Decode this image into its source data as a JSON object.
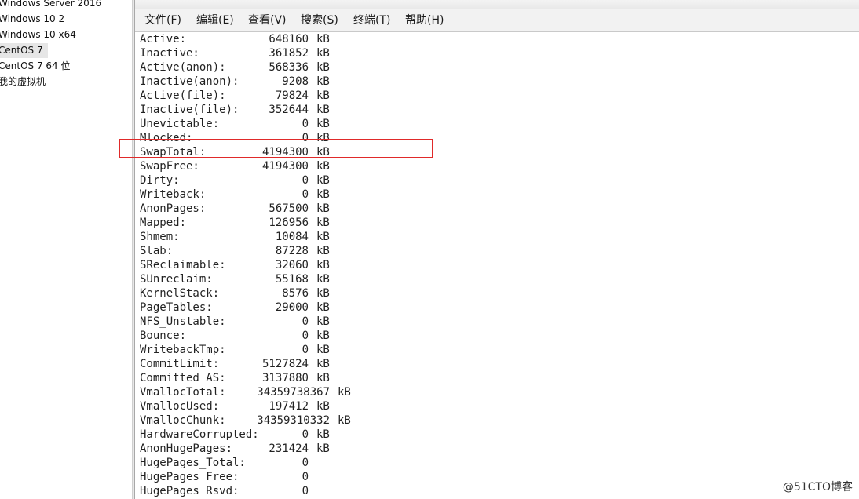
{
  "library": {
    "items": [
      {
        "label": "Windows Server 2016",
        "selected": false
      },
      {
        "label": "Windows 10 2",
        "selected": false
      },
      {
        "label": "Windows 10 x64",
        "selected": false
      },
      {
        "label": "CentOS 7",
        "selected": true
      },
      {
        "label": "CentOS 7 64 位",
        "selected": false
      },
      {
        "label": "我的虚拟机",
        "selected": false
      }
    ]
  },
  "menubar": {
    "items": [
      "文件(F)",
      "编辑(E)",
      "查看(V)",
      "搜索(S)",
      "终端(T)",
      "帮助(H)"
    ]
  },
  "meminfo": {
    "highlighted_key": "SwapTotal:",
    "rows": [
      {
        "key": "Active:",
        "value": "648160",
        "unit": "kB"
      },
      {
        "key": "Inactive:",
        "value": "361852",
        "unit": "kB"
      },
      {
        "key": "Active(anon):",
        "value": "568336",
        "unit": "kB"
      },
      {
        "key": "Inactive(anon):",
        "value": "9208",
        "unit": "kB"
      },
      {
        "key": "Active(file):",
        "value": "79824",
        "unit": "kB"
      },
      {
        "key": "Inactive(file):",
        "value": "352644",
        "unit": "kB"
      },
      {
        "key": "Unevictable:",
        "value": "0",
        "unit": "kB"
      },
      {
        "key": "Mlocked:",
        "value": "0",
        "unit": "kB"
      },
      {
        "key": "SwapTotal:",
        "value": "4194300",
        "unit": "kB"
      },
      {
        "key": "SwapFree:",
        "value": "4194300",
        "unit": "kB"
      },
      {
        "key": "Dirty:",
        "value": "0",
        "unit": "kB"
      },
      {
        "key": "Writeback:",
        "value": "0",
        "unit": "kB"
      },
      {
        "key": "AnonPages:",
        "value": "567500",
        "unit": "kB"
      },
      {
        "key": "Mapped:",
        "value": "126956",
        "unit": "kB"
      },
      {
        "key": "Shmem:",
        "value": "10084",
        "unit": "kB"
      },
      {
        "key": "Slab:",
        "value": "87228",
        "unit": "kB"
      },
      {
        "key": "SReclaimable:",
        "value": "32060",
        "unit": "kB"
      },
      {
        "key": "SUnreclaim:",
        "value": "55168",
        "unit": "kB"
      },
      {
        "key": "KernelStack:",
        "value": "8576",
        "unit": "kB"
      },
      {
        "key": "PageTables:",
        "value": "29000",
        "unit": "kB"
      },
      {
        "key": "NFS_Unstable:",
        "value": "0",
        "unit": "kB"
      },
      {
        "key": "Bounce:",
        "value": "0",
        "unit": "kB"
      },
      {
        "key": "WritebackTmp:",
        "value": "0",
        "unit": "kB"
      },
      {
        "key": "CommitLimit:",
        "value": "5127824",
        "unit": "kB"
      },
      {
        "key": "Committed_AS:",
        "value": "3137880",
        "unit": "kB"
      },
      {
        "key": "VmallocTotal:",
        "value": "34359738367",
        "unit": "kB"
      },
      {
        "key": "VmallocUsed:",
        "value": "197412",
        "unit": "kB"
      },
      {
        "key": "VmallocChunk:",
        "value": "34359310332",
        "unit": "kB"
      },
      {
        "key": "HardwareCorrupted:",
        "value": "0",
        "unit": "kB"
      },
      {
        "key": "AnonHugePages:",
        "value": "231424",
        "unit": "kB"
      },
      {
        "key": "HugePages_Total:",
        "value": "0",
        "unit": ""
      },
      {
        "key": "HugePages_Free:",
        "value": "0",
        "unit": ""
      },
      {
        "key": "HugePages_Rsvd:",
        "value": "0",
        "unit": ""
      }
    ]
  },
  "watermark": "@51CTO博客",
  "colors": {
    "highlight_border": "#e02a2a",
    "terminal_text": "#222222"
  }
}
